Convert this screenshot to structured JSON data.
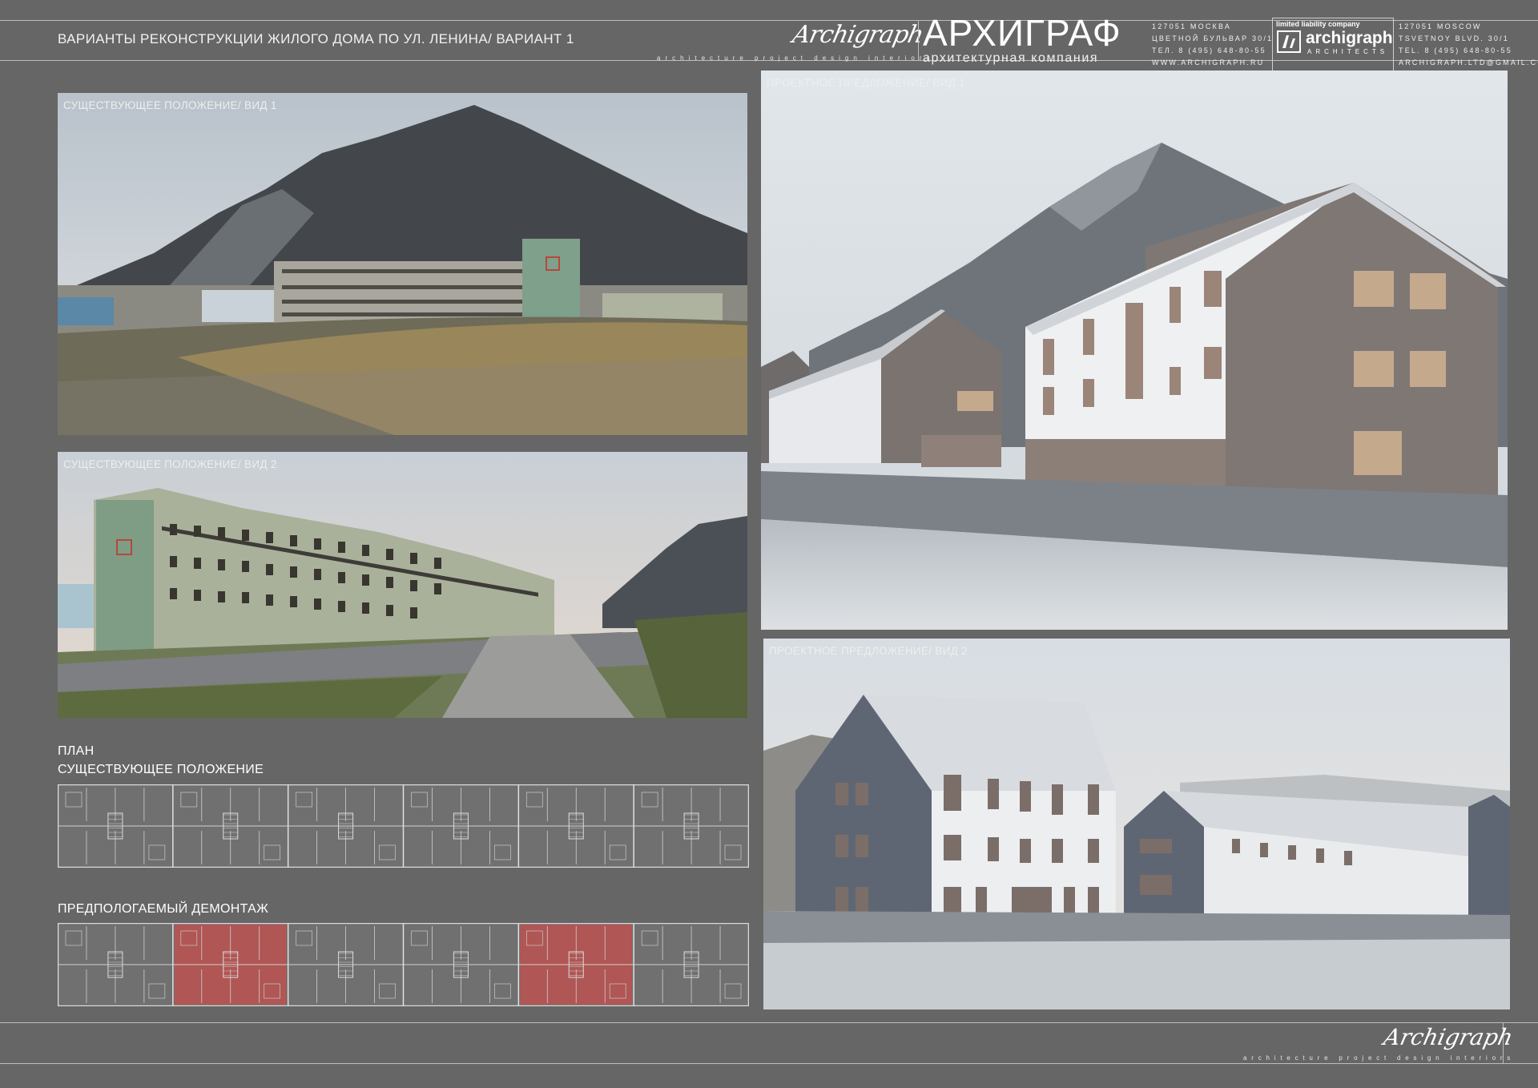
{
  "header": {
    "title": "ВАРИАНТЫ РЕКОНСТРУКЦИИ ЖИЛОГО ДОМА ПО УЛ. ЛЕНИНА/ ВАРИАНТ 1",
    "logo_tagline": "architecture  project  design  interiors",
    "brand_ru": "АРХИГРАФ",
    "brand_sub": "архитектурная компания",
    "address_ru": [
      "127051 МОСКВА",
      "ЦВЕТНОЙ БУЛЬВАР 30/1",
      "ТЕЛ. 8 (495) 648-80-55",
      "WWW.ARCHIGRAPH.RU"
    ],
    "address_en": [
      "127051 MOSCOW",
      "TSVETNOY BLVD. 30/1",
      "TEL. 8 (495) 648-80-55",
      "ARCHIGRAPH.LTD@GMAIL.COM"
    ],
    "llc_label": "limited liability company",
    "llc_name": "archigraph",
    "llc_sub": "ARCHITECTS"
  },
  "panels": {
    "existing_view_1": "СУЩЕСТВУЮЩЕЕ ПОЛОЖЕНИЕ/ ВИД 1",
    "existing_view_2": "СУЩЕСТВУЮЩЕЕ ПОЛОЖЕНИЕ/ ВИД 2",
    "proposal_view_1": "ПРОЕКТНОЕ ПРЕДЛОЖЕНИЕ/ ВИД 1",
    "proposal_view_2": "ПРОЕКТНОЕ ПРЕДЛОЖЕНИЕ/ ВИД 2"
  },
  "plans": {
    "title": "ПЛАН",
    "existing": "СУЩЕСТВУЮЩЕЕ ПОЛОЖЕНИЕ",
    "demolition": "ПРЕДПОЛОГАЕМЫЙ ДЕМОНТАЖ",
    "sections": 6,
    "demolished_sections": [
      2,
      5
    ]
  },
  "colors": {
    "background": "#666666",
    "demolition_highlight": "#c0504d"
  },
  "footer": {
    "tagline": "architecture  project  design  interiors"
  }
}
